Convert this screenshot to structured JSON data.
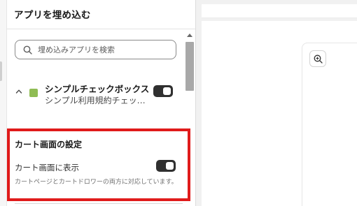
{
  "sidebar": {
    "title": "アプリを埋め込む",
    "search": {
      "placeholder": "埋め込みアプリを検索",
      "value": ""
    },
    "app": {
      "name": "シンプルチェックボックス",
      "description": "シンプル利用規約チェックボックス",
      "enabled": true,
      "color": "#8fbc54"
    },
    "cart_settings": {
      "title": "カート画面の設定",
      "toggle_label": "カート画面に表示",
      "toggle_on": true,
      "help_text": "カートページとカートドロワーの両方に対応しています。"
    }
  },
  "preview": {
    "zoom_icon": "zoom-in-icon"
  },
  "colors": {
    "highlight": "#e01b1b",
    "toggle": "#303030"
  }
}
